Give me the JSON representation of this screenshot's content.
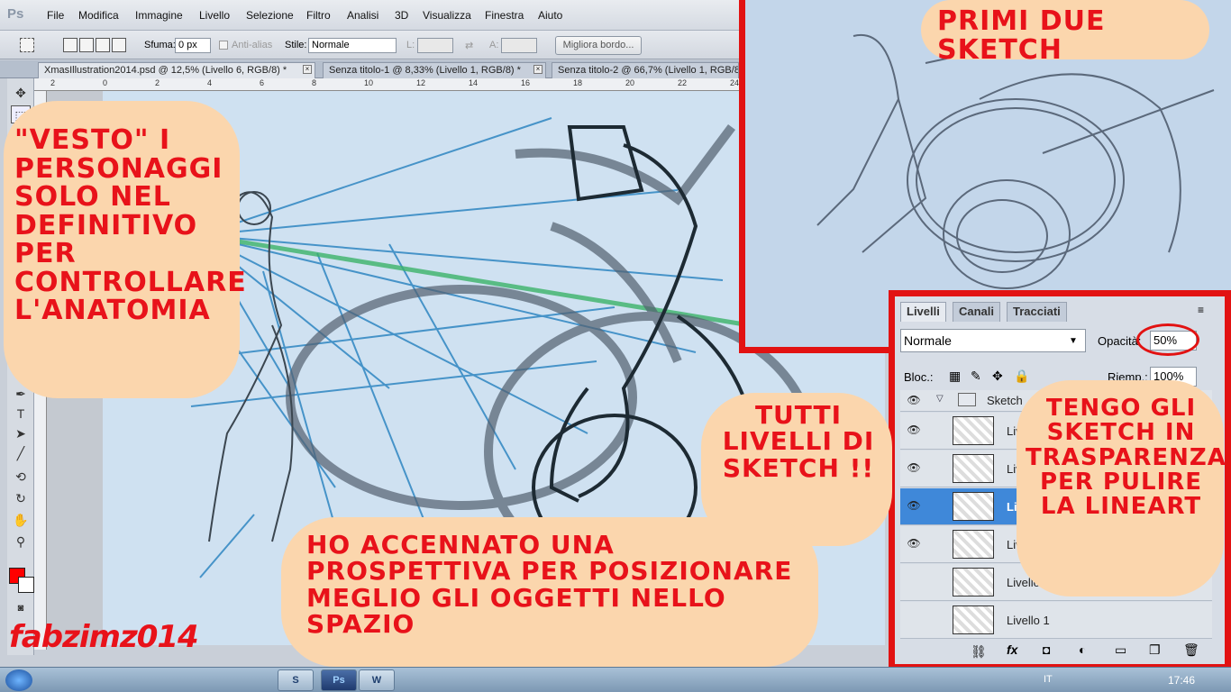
{
  "app": {
    "logo": "Ps"
  },
  "menu": [
    "File",
    "Modifica",
    "Immagine",
    "Livello",
    "Selezione",
    "Filtro",
    "Analisi",
    "3D",
    "Visualizza",
    "Finestra",
    "Aiuto"
  ],
  "options": {
    "feather_label": "Sfuma:",
    "feather_value": "0 px",
    "antialias_label": "Anti-alias",
    "style_label": "Stile:",
    "style_value": "Normale",
    "width_label": "L:",
    "height_label": "A:",
    "refine_button": "Migliora bordo..."
  },
  "tabs": [
    {
      "label": "XmasIllustration2014.psd @ 12,5% (Livello 6, RGB/8) *"
    },
    {
      "label": "Senza titolo-1 @ 8,33% (Livello 1, RGB/8) *"
    },
    {
      "label": "Senza titolo-2 @ 66,7% (Livello 1, RGB/8"
    }
  ],
  "ruler_ticks": [
    "2",
    "0",
    "2",
    "4",
    "6",
    "8",
    "10",
    "12",
    "14",
    "16",
    "18",
    "20",
    "22",
    "24"
  ],
  "layers_panel": {
    "tabs": [
      "Livelli",
      "Canali",
      "Tracciati"
    ],
    "blend_mode": "Normale",
    "opacity_label": "Opacità:",
    "opacity_value": "50%",
    "lock_label": "Bloc.:",
    "fill_label": "Riemp.:",
    "fill_value": "100%",
    "group_name": "Sketch",
    "layers": [
      {
        "name": "Livello",
        "selected": false,
        "visible": true
      },
      {
        "name": "Liv",
        "selected": false,
        "visible": true
      },
      {
        "name": "Liv",
        "selected": true,
        "visible": true
      },
      {
        "name": "Liv",
        "selected": false,
        "visible": true
      },
      {
        "name": "Livello 2",
        "selected": false,
        "visible": false
      },
      {
        "name": "Livello 1",
        "selected": false,
        "visible": false
      }
    ]
  },
  "annotations": {
    "top_left": "\"Vesto\" i personaggi solo nel definitivo per controllare l'anatomia",
    "inset": "Primi due sketch",
    "layers_left": "Tutti livelli di sketch !!",
    "layers_right": "Tengo gli sketch in trasparenza per pulire la lineart",
    "bottom": "Ho accennato una prospettiva per posizionare meglio gli oggetti nello spazio",
    "signature": "fabzimz014"
  },
  "taskbar": {
    "language": "IT",
    "time": "17:46"
  },
  "colors": {
    "accent_red": "#e21212",
    "annotation_bg": "#fbd6ad",
    "foreground_color": "#ff0000",
    "selected_layer": "#3f88d9"
  }
}
